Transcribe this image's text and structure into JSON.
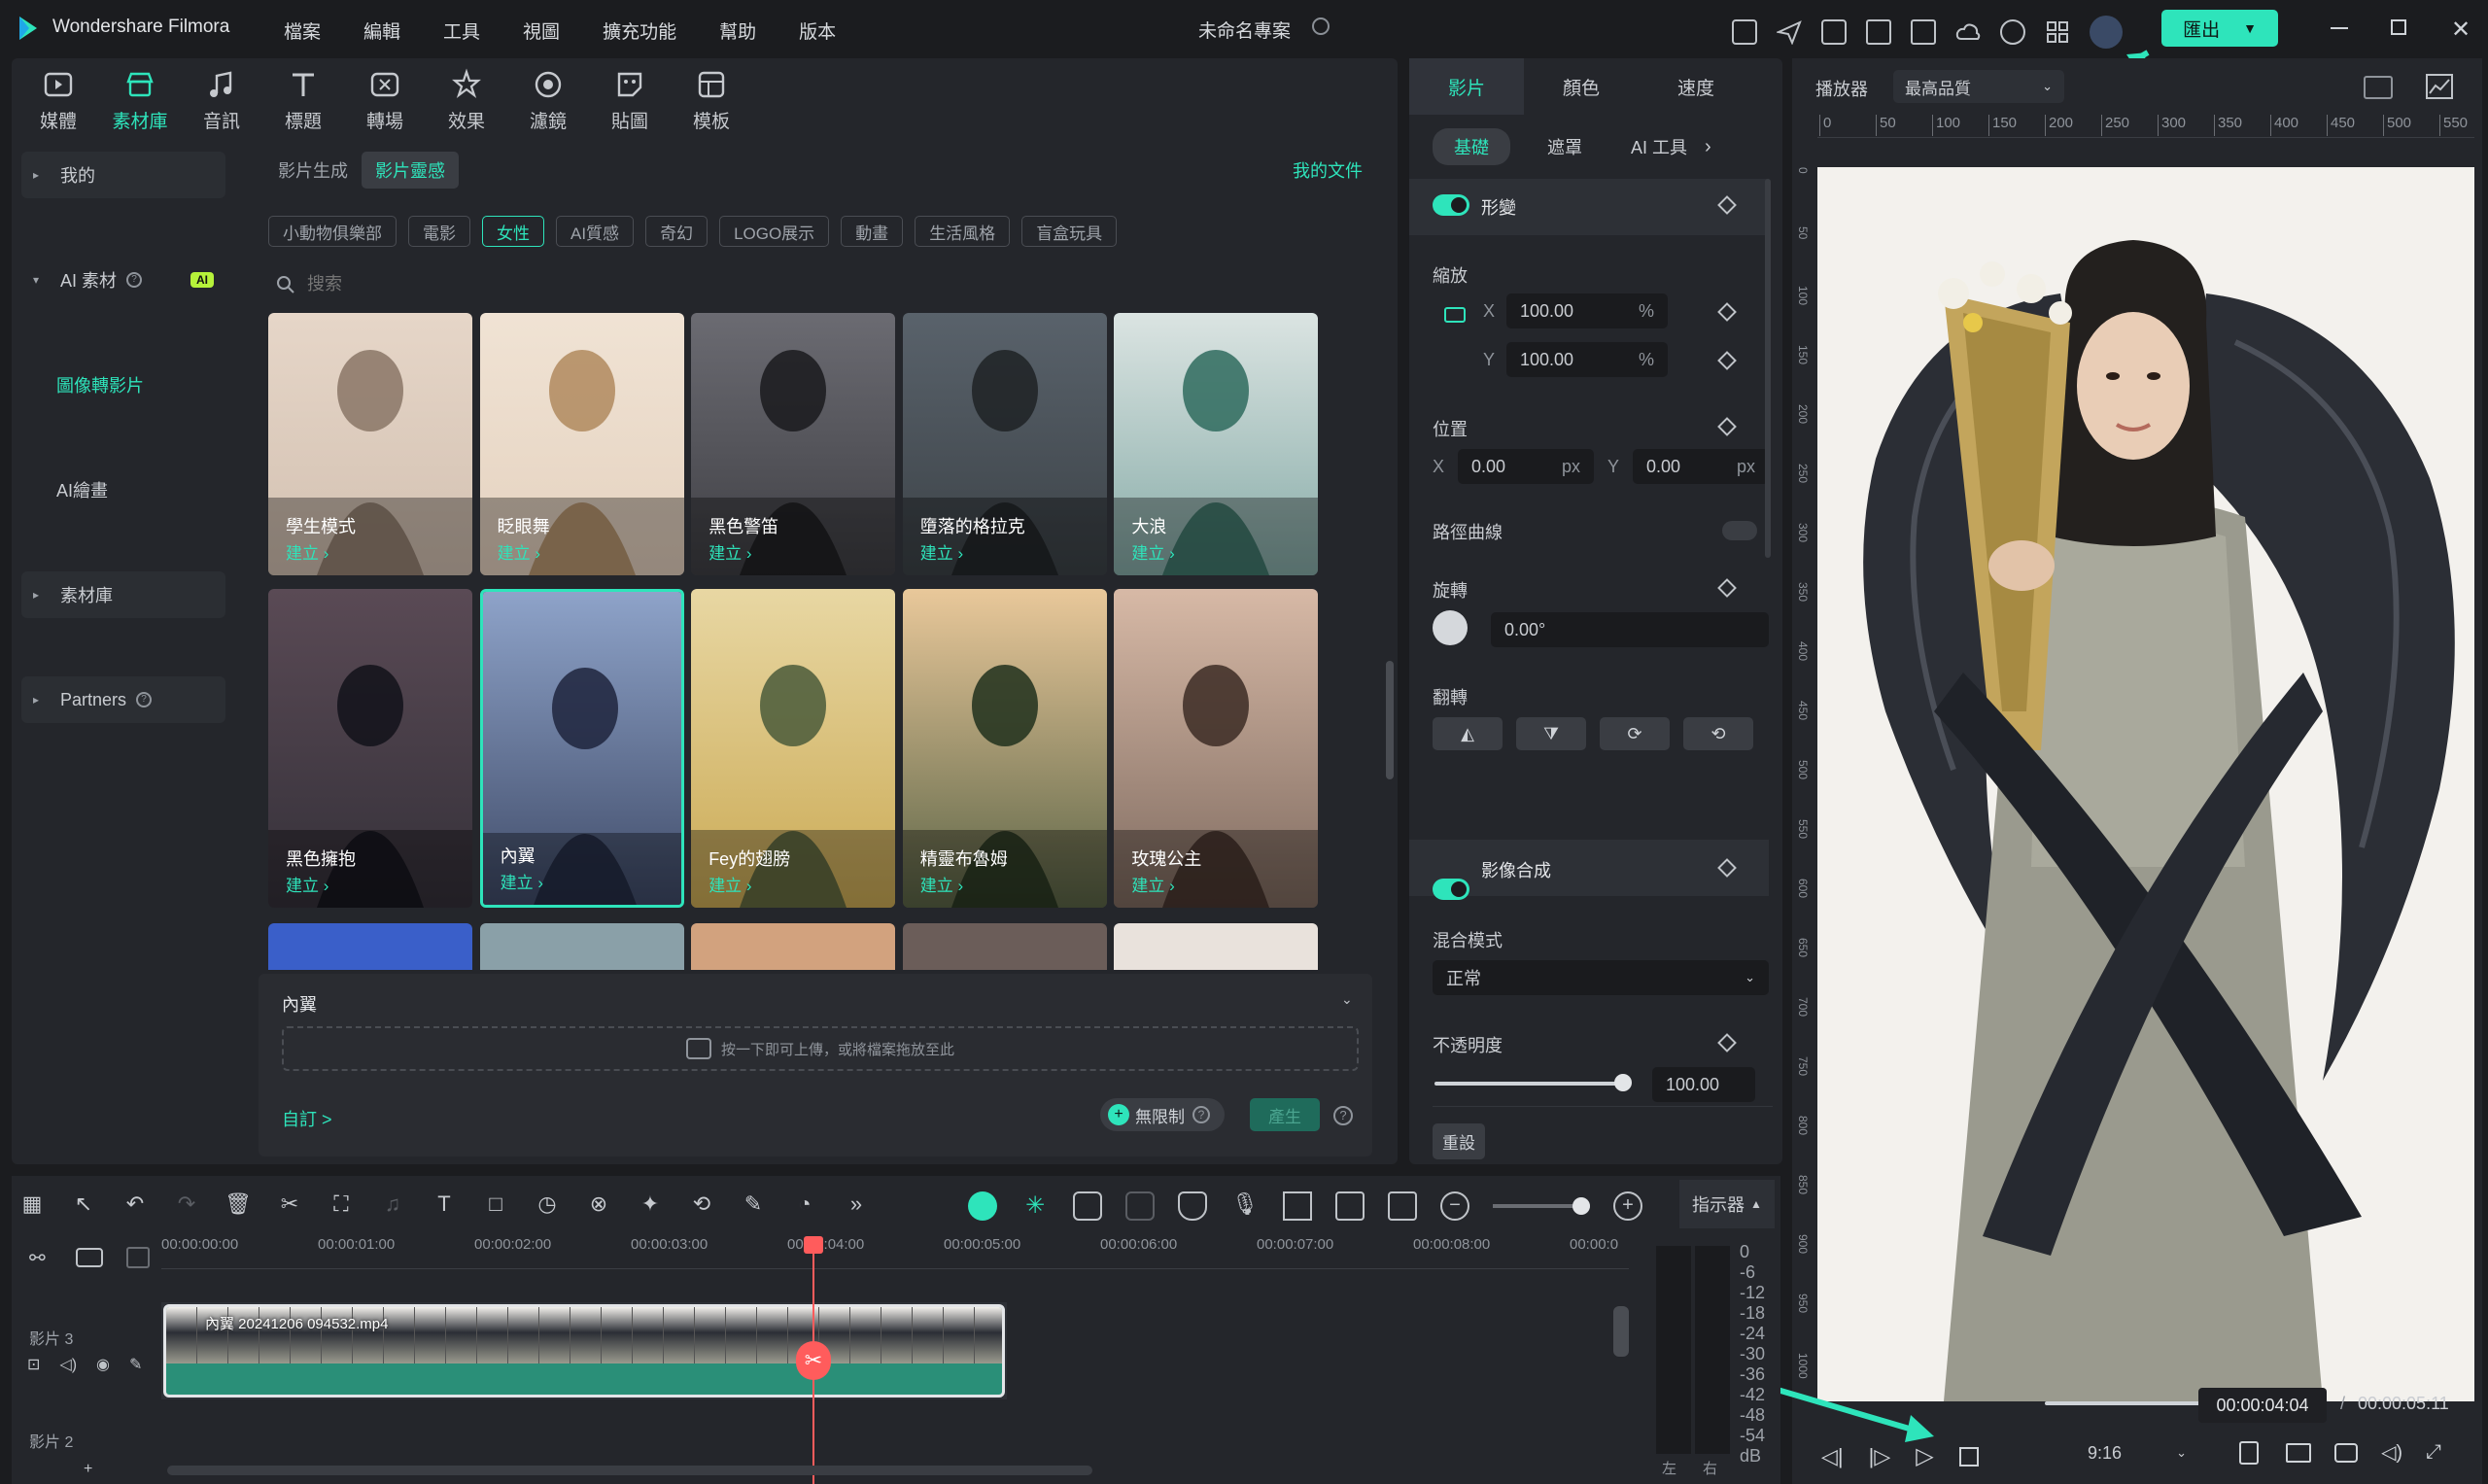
{
  "app": {
    "name": "Wondershare Filmora",
    "project_title": "未命名專案",
    "export_label": "匯出",
    "menus": [
      "檔案",
      "編輯",
      "工具",
      "視圖",
      "擴充功能",
      "幫助",
      "版本"
    ]
  },
  "toolbar": {
    "items": [
      {
        "label": "媒體",
        "icon": "media-icon"
      },
      {
        "label": "素材庫",
        "icon": "stock-icon"
      },
      {
        "label": "音訊",
        "icon": "audio-icon"
      },
      {
        "label": "標題",
        "icon": "title-icon"
      },
      {
        "label": "轉場",
        "icon": "transition-icon"
      },
      {
        "label": "效果",
        "icon": "effects-icon"
      },
      {
        "label": "濾鏡",
        "icon": "filter-icon"
      },
      {
        "label": "貼圖",
        "icon": "sticker-icon"
      },
      {
        "label": "模板",
        "icon": "template-icon"
      }
    ],
    "active_index": 1
  },
  "sidebar": {
    "items": [
      {
        "label": "我的"
      },
      {
        "label": "AI 素材",
        "badge": "AI"
      },
      {
        "label": "圖像轉影片"
      },
      {
        "label": "AI繪畫"
      },
      {
        "label": "素材庫"
      },
      {
        "label": "Partners"
      }
    ]
  },
  "library": {
    "tabs": [
      "影片生成",
      "影片靈感"
    ],
    "active_tab": 1,
    "my_files": "我的文件",
    "chips": [
      "小動物俱樂部",
      "電影",
      "女性",
      "AI質感",
      "奇幻",
      "LOGO展示",
      "動畫",
      "生活風格",
      "盲盒玩具"
    ],
    "active_chip": 2,
    "search_placeholder": "搜索",
    "create_label": "建立 ›",
    "items": [
      {
        "title": "學生模式"
      },
      {
        "title": "眨眼舞"
      },
      {
        "title": "黑色警笛"
      },
      {
        "title": "墮落的格拉克"
      },
      {
        "title": "大浪"
      },
      {
        "title": "黑色擁抱"
      },
      {
        "title": "內翼"
      },
      {
        "title": "Fey的翅膀"
      },
      {
        "title": "精靈布魯姆"
      },
      {
        "title": "玫瑰公主"
      }
    ]
  },
  "generator": {
    "title": "內翼",
    "upload_hint": "按一下即可上傳，或將檔案拖放至此",
    "custom_label": "自訂 >",
    "unlimited_label": "無限制",
    "generate_label": "產生"
  },
  "properties": {
    "tabs": [
      "影片",
      "顏色",
      "速度"
    ],
    "subtabs": [
      "基礎",
      "遮罩",
      "AI 工具"
    ],
    "transform": "形變",
    "scale": "縮放",
    "scale_x": "100.00",
    "scale_y": "100.00",
    "percent": "%",
    "position": "位置",
    "pos_x": "0.00",
    "pos_y": "0.00",
    "px": "px",
    "path_curve": "路徑曲線",
    "rotate": "旋轉",
    "rotate_value": "0.00°",
    "flip": "翻轉",
    "compositing": "影像合成",
    "blend_mode": "混合模式",
    "blend_value": "正常",
    "opacity": "不透明度",
    "opacity_value": "100.00",
    "opacity_level": 1.0,
    "reset": "重設",
    "x": "X",
    "y": "Y"
  },
  "player": {
    "label": "播放器",
    "quality": "最高品質",
    "ruler": [
      "0",
      "50",
      "100",
      "150",
      "200",
      "250",
      "300",
      "350",
      "400",
      "450",
      "500",
      "550"
    ],
    "vruler": [
      "0",
      "50",
      "100",
      "150",
      "200",
      "250",
      "300",
      "350",
      "400",
      "450",
      "500",
      "550",
      "600",
      "650",
      "700",
      "750",
      "800",
      "850",
      "900",
      "950",
      "1000"
    ],
    "current_time": "00:00:04:04",
    "separator": "/",
    "total_time": "00:00:05:11",
    "progress": 0.8,
    "ratio": "9:16"
  },
  "timeline": {
    "marker_label": "指示器",
    "times": [
      "00:00:00:00",
      "00:00:01:00",
      "00:00:02:00",
      "00:00:03:00",
      "00:00:04:00",
      "00:00:05:00",
      "00:00:06:00",
      "00:00:07:00",
      "00:00:08:00",
      "00:00:0"
    ],
    "track3": "影片 3",
    "track2": "影片 2",
    "clip_label": "內翼 20241206 094532.mp4",
    "meter": [
      "0",
      "-6",
      "-12",
      "-18",
      "-24",
      "-30",
      "-36",
      "-42",
      "-48",
      "-54",
      "dB"
    ],
    "meter_left": "左",
    "meter_right": "右"
  },
  "colors": {
    "accent": "#2ee4bb",
    "bg": "#1b1c1f",
    "panel": "#24262b"
  }
}
